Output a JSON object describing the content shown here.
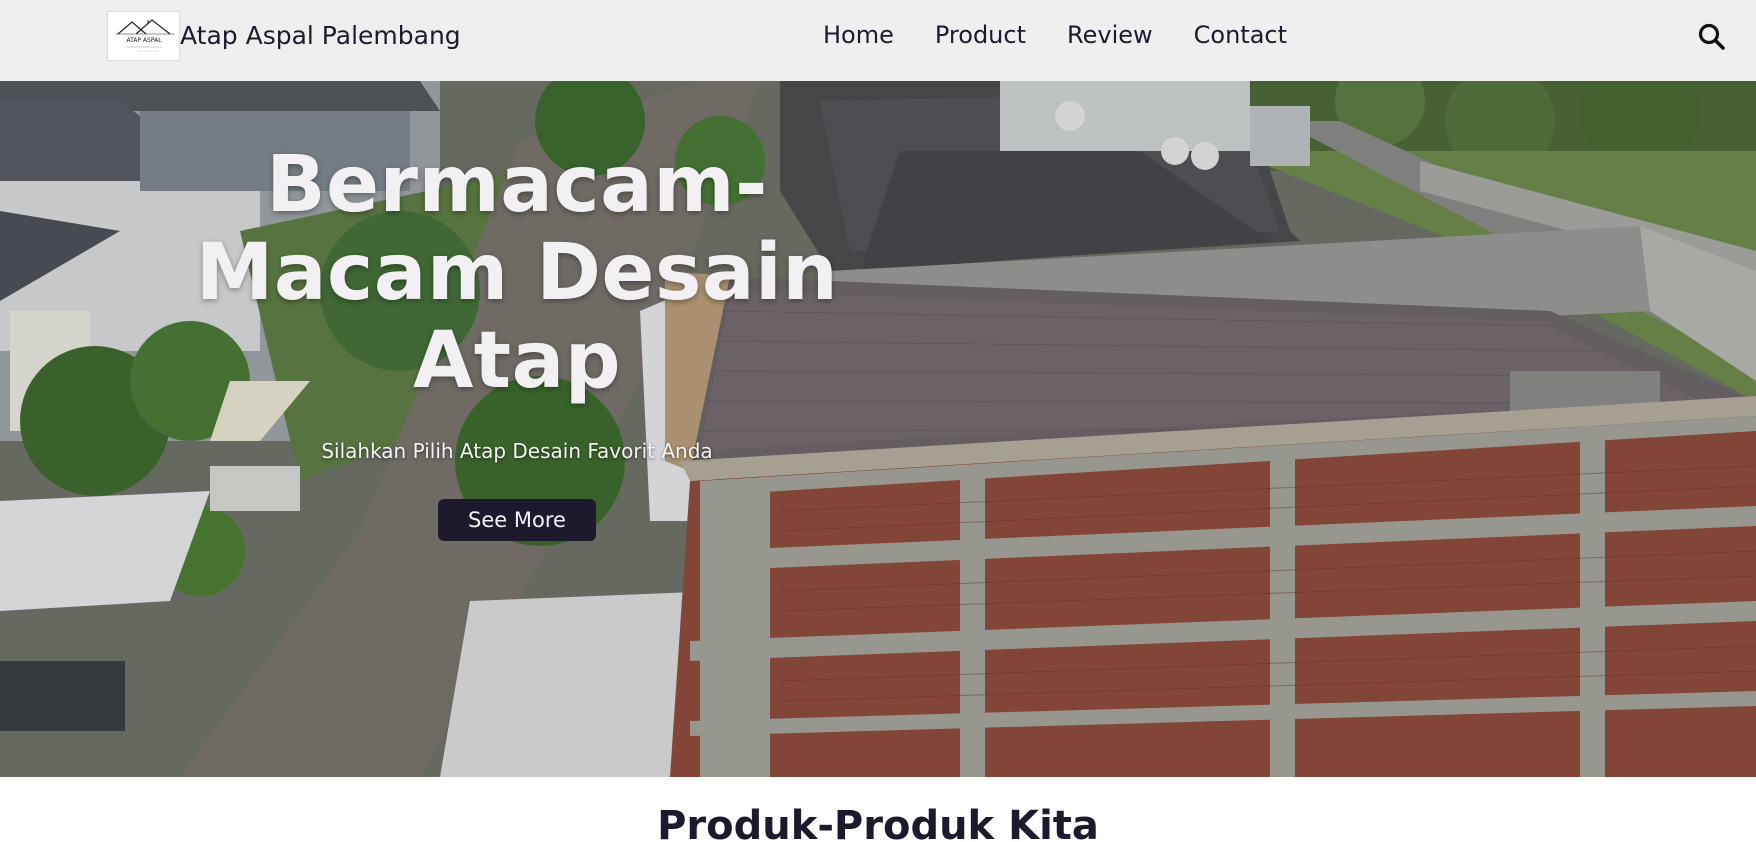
{
  "navbar": {
    "brand": "Atap Aspal Palembang",
    "logo_text": "ATAP ASPAL",
    "links": [
      {
        "label": "Home"
      },
      {
        "label": "Product"
      },
      {
        "label": "Review"
      },
      {
        "label": "Contact"
      }
    ],
    "search_icon": "search-icon"
  },
  "hero": {
    "title_lines": [
      "Bermacam-",
      "Macam Desain",
      "Atap"
    ],
    "subtitle": "Silahkan Pilih Atap Desain Favorit Anda",
    "button_label": "See More"
  },
  "products": {
    "heading": "Produk-Produk Kita"
  },
  "colors": {
    "navbar_bg": "#efefef",
    "dark": "#1e1a2e",
    "hero_text": "#f2f0f2"
  }
}
